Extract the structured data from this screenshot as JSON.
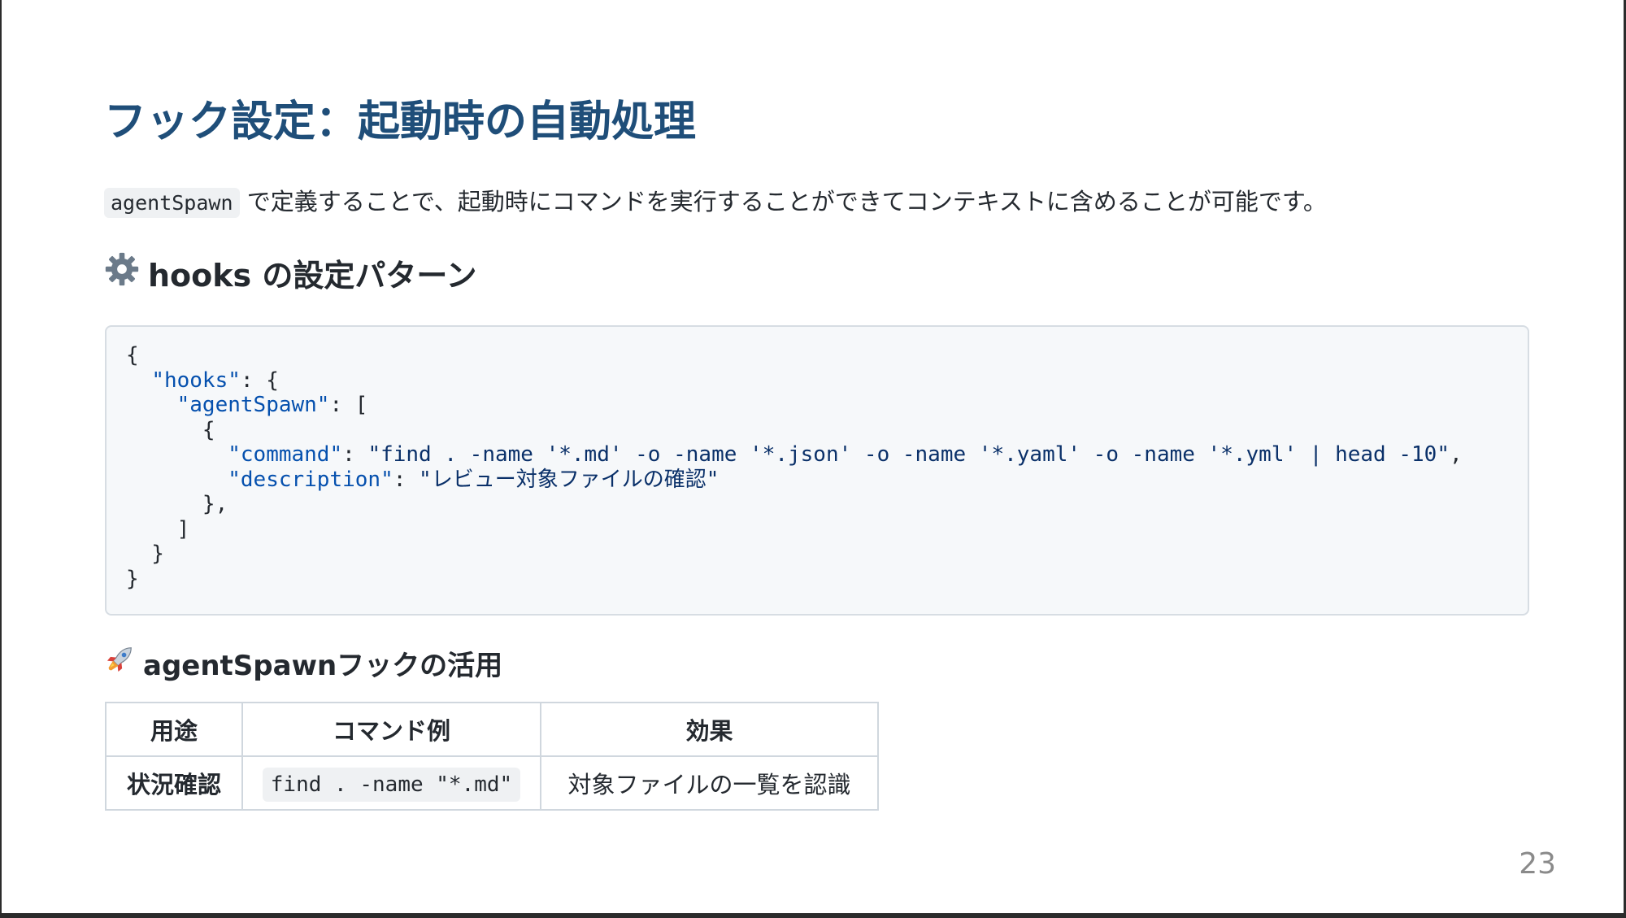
{
  "slide": {
    "title": "フック設定：起動時の自動処理",
    "intro": {
      "code": "agentSpawn",
      "text": "で定義することで、起動時にコマンドを実行することができてコンテキストに含めることが可能です。"
    },
    "hooks_heading": {
      "icon": "gear-icon",
      "icon_glyph": "⚙️",
      "text": "hooks の設定パターン"
    },
    "code_lines": [
      "{",
      "  \"hooks\": {",
      "    \"agentSpawn\": [",
      "      {",
      "        \"command\": \"find . -name '*.md' -o -name '*.json' -o -name '*.yaml' -o -name '*.yml' | head -10\",",
      "        \"description\": \"レビュー対象ファイルの確認\"",
      "      },",
      "    ]",
      "  }",
      "}"
    ],
    "agent_heading": {
      "icon": "rocket-icon",
      "icon_glyph": "🚀",
      "text": "agentSpawnフックの活用"
    },
    "table": {
      "headers": [
        "用途",
        "コマンド例",
        "効果"
      ],
      "rows": [
        {
          "usage": "状況確認",
          "command": "find . -name \"*.md\"",
          "effect": "対象ファイルの一覧を認識"
        }
      ]
    },
    "page_number": "23"
  }
}
